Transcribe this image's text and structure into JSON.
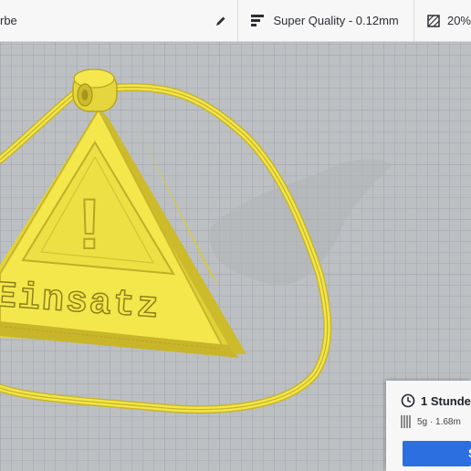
{
  "header": {
    "material_label": "rbe",
    "quality_label": "Super Quality - 0.12mm",
    "infill_label": "20%"
  },
  "model": {
    "embossed_text": "Einsatz",
    "warning_symbol": "!"
  },
  "estimate": {
    "time_label": "1 Stunde",
    "material_label": "5g · 1.68m"
  },
  "actions": {
    "slice_label": "S"
  },
  "colors": {
    "model_yellow": "#f2e64a",
    "accent_blue": "#2b6fe0",
    "panel_bg": "#f7f7f8"
  }
}
